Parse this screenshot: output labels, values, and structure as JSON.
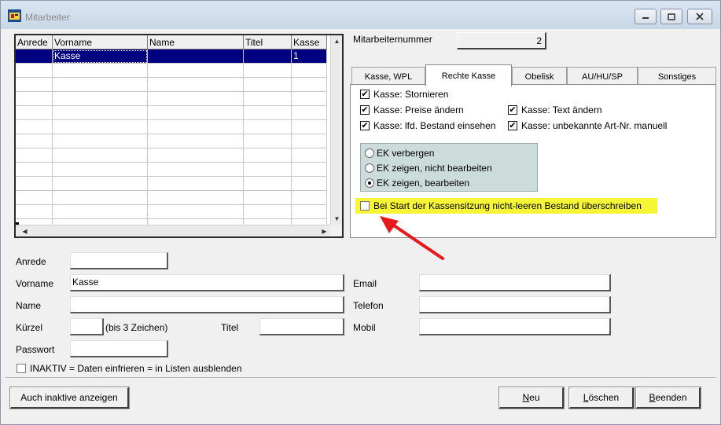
{
  "window": {
    "title": "Mitarbeiter"
  },
  "grid": {
    "columns": [
      "Anrede",
      "Vorname",
      "Name",
      "Titel",
      "Kasse"
    ],
    "rows": [
      [
        "",
        "Kasse",
        "",
        "",
        "1"
      ]
    ]
  },
  "employee_number": {
    "label": "Mitarbeiternummer",
    "value": "2"
  },
  "tabs": [
    {
      "label": "Kasse, WPL",
      "active": false
    },
    {
      "label": "Rechte Kasse",
      "active": true
    },
    {
      "label": "Obelisk",
      "active": false
    },
    {
      "label": "AU/HU/SP",
      "active": false
    },
    {
      "label": "Sonstiges",
      "active": false
    }
  ],
  "permissions": {
    "storno": {
      "label": "Kasse: Stornieren",
      "checked": true
    },
    "prices": {
      "label": "Kasse: Preise ändern",
      "checked": true
    },
    "stock": {
      "label": "Kasse: lfd. Bestand einsehen",
      "checked": true
    },
    "text": {
      "label": "Kasse: Text ändern",
      "checked": true
    },
    "unknown_article": {
      "label": "Kasse: unbekannte Art-Nr. manuell",
      "checked": true
    }
  },
  "ek_options": {
    "hide": "EK verbergen",
    "show_readonly": "EK zeigen, nicht bearbeiten",
    "show_edit": "EK zeigen, bearbeiten",
    "selected": "show_edit"
  },
  "overwrite_stock": {
    "label": "Bei Start der Kassensitzung nicht-leeren Bestand überschreiben",
    "checked": false
  },
  "form": {
    "anrede_label": "Anrede",
    "anrede_value": "",
    "vorname_label": "Vorname",
    "vorname_value": "Kasse",
    "name_label": "Name",
    "name_value": "",
    "kuerzel_label": "Kürzel",
    "kuerzel_value": "",
    "kuerzel_hint": "(bis 3 Zeichen)",
    "titel_label": "Titel",
    "titel_value": "",
    "passwort_label": "Passwort",
    "passwort_value": "",
    "email_label": "Email",
    "email_value": "",
    "telefon_label": "Telefon",
    "telefon_value": "",
    "mobil_label": "Mobil",
    "mobil_value": "",
    "inactive_label": "INAKTIV = Daten einfrieren = in Listen ausblenden",
    "inactive_checked": false
  },
  "buttons": {
    "show_inactive": "Auch inaktive anzeigen",
    "new_prefix": "",
    "new_u": "N",
    "new_rest": "eu",
    "delete_u": "L",
    "delete_rest": "öschen",
    "quit_u": "B",
    "quit_rest": "eenden"
  },
  "colors": {
    "selection": "#000080",
    "highlight": "#f6f637",
    "radio_group_bg": "#cbdcdb",
    "arrow": "#e8191b"
  }
}
